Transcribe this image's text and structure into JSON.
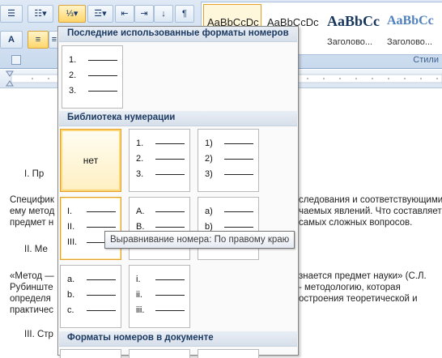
{
  "ribbon": {
    "group_label_styles": "Стили",
    "styles": [
      {
        "sample": "AaBbCcDc",
        "name": ""
      },
      {
        "sample": "AaBbCcDc",
        "name": ""
      },
      {
        "sample": "AaBbCc",
        "name": "Заголово..."
      },
      {
        "sample": "AaBbCc",
        "name": "Заголово..."
      }
    ],
    "pilcrow": "¶",
    "font_color_letter": "A"
  },
  "document": {
    "lines": [
      "I.     Пр",
      "Специфик",
      "ему метод",
      "предмет н",
      "II.     Ме",
      "«Метод —",
      "Рубинште",
      "определя",
      "практичес",
      "III.     Стр",
      "следования и соответствующими",
      "чаемых явлений. Что составляет",
      "самых сложных вопросов.",
      "знается предмет науки» (С.Л.",
      "- методологию, которая",
      "остроения теоретической и"
    ]
  },
  "menu": {
    "recent_header": "Последние использованные форматы номеров",
    "library_header": "Библиотека нумерации",
    "document_header": "Форматы номеров в документе",
    "none_label": "нет",
    "recent": [
      [
        "1.",
        "2.",
        "3."
      ]
    ],
    "library": [
      [
        "1.",
        "2.",
        "3."
      ],
      [
        "1)",
        "2)",
        "3)"
      ],
      [
        "I.",
        "II.",
        "III."
      ],
      [
        "A.",
        "B.",
        "C."
      ],
      [
        "a)",
        "b)",
        "c)"
      ],
      [
        "a.",
        "b.",
        "c."
      ],
      [
        "i.",
        "ii.",
        "iii."
      ]
    ]
  },
  "tooltip": "Выравнивание номера: По правому краю"
}
